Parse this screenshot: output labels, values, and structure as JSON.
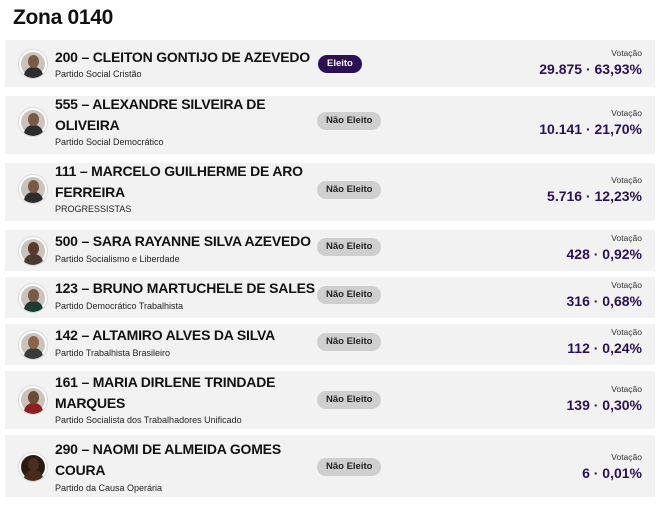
{
  "zone": {
    "title": "Zona 0140"
  },
  "labels": {
    "votes": "Votação"
  },
  "candidates": [
    {
      "name": "200 – CLEITON GONTIJO DE AZEVEDO",
      "party": "Partido Social Cristão",
      "status": "Eleito",
      "votes": "29.875 · 63,93%"
    },
    {
      "name": "555 – ALEXANDRE SILVEIRA DE OLIVEIRA",
      "party": "Partido Social Democrático",
      "status": "Não Eleito",
      "votes": "10.141 · 21,70%"
    },
    {
      "name": "111 – MARCELO GUILHERME DE ARO FERREIRA",
      "party": "PROGRESSISTAS",
      "status": "Não Eleito",
      "votes": "5.716 · 12,23%"
    },
    {
      "name": "500 – SARA RAYANNE SILVA AZEVEDO",
      "party": "Partido Socialismo e Liberdade",
      "status": "Não Eleito",
      "votes": "428 · 0,92%"
    },
    {
      "name": "123 – BRUNO MARTUCHELE DE SALES",
      "party": "Partido Democrático Trabalhista",
      "status": "Não Eleito",
      "votes": "316 · 0,68%"
    },
    {
      "name": "142 – ALTAMIRO ALVES DA SILVA",
      "party": "Partido Trabalhista Brasileiro",
      "status": "Não Eleito",
      "votes": "112 · 0,24%"
    },
    {
      "name": "161 – MARIA DIRLENE TRINDADE MARQUES",
      "party": "Partido Socialista dos Trabalhadores Unificado",
      "status": "Não Eleito",
      "votes": "139 · 0,30%"
    },
    {
      "name": "290 – NAOMI DE ALMEIDA GOMES COURA",
      "party": "Partido da Causa Operária",
      "status": "Não Eleito",
      "votes": "6 · 0,01%"
    }
  ],
  "colors": {
    "accent": "#2b1154",
    "row_bg": "#f2f2f2",
    "badge_grey": "#cfcfcf"
  }
}
